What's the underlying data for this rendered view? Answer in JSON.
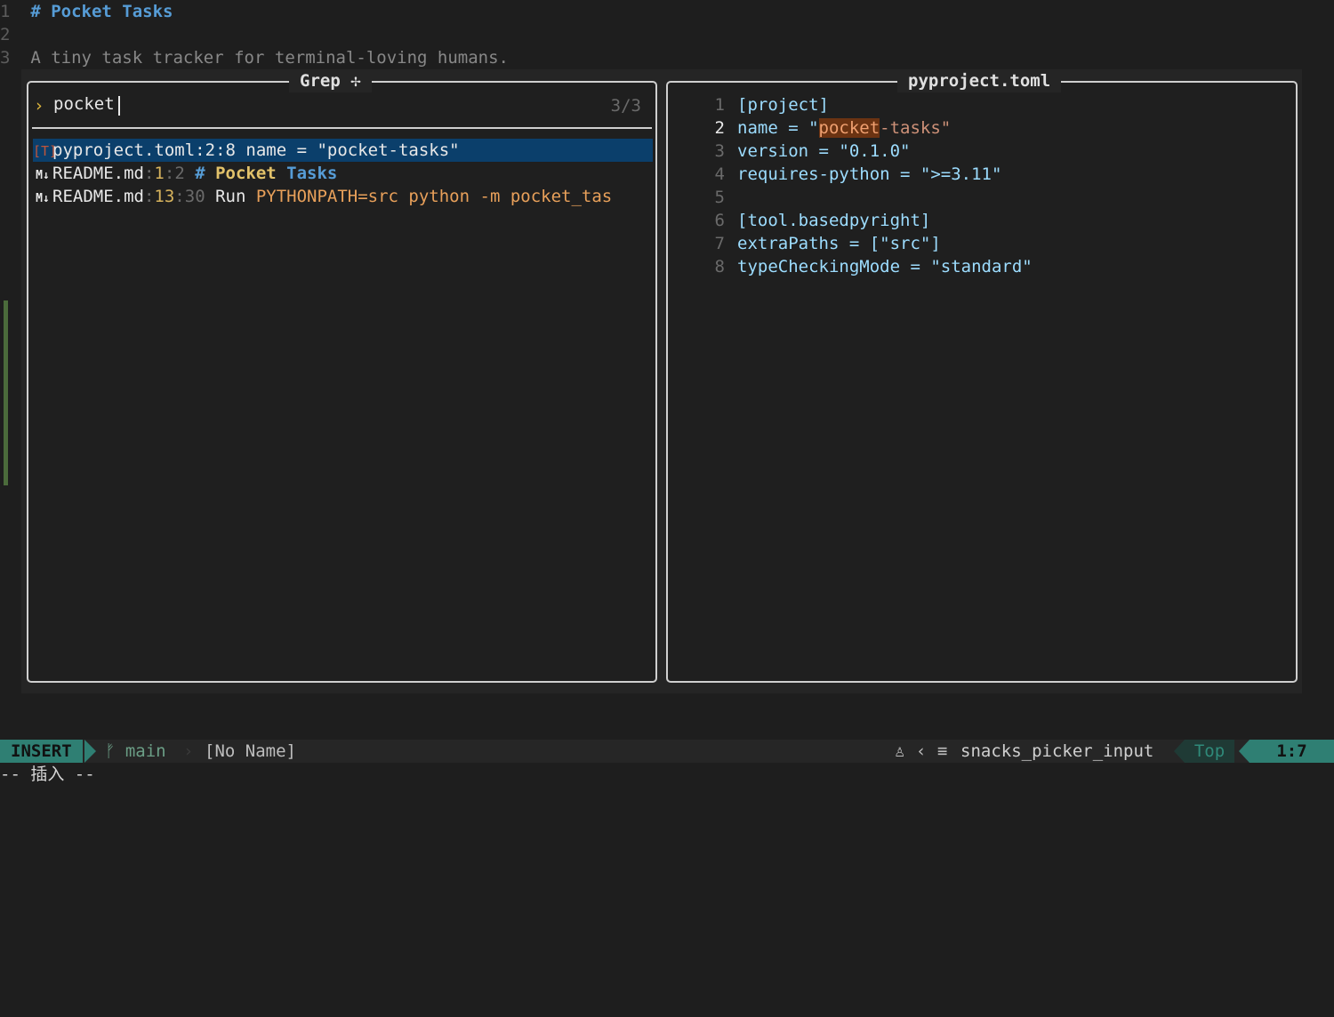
{
  "background_editor": {
    "lines": [
      {
        "num": "1",
        "text": "# Pocket Tasks"
      },
      {
        "num": "2",
        "text": ""
      },
      {
        "num": "3",
        "text": "A tiny task tracker for terminal-loving humans."
      }
    ]
  },
  "picker": {
    "title": "Grep",
    "title_icon": "✢",
    "prompt": "›",
    "query": "pocket",
    "match_count": "3/3",
    "results": [
      {
        "icon": "[T]",
        "file": "pyproject.toml",
        "sep1": ":",
        "line": "2",
        "sep2": ":",
        "col": "8",
        "text_pre": " name = \"pocket-tasks\"",
        "text_hl": "",
        "text_post": ""
      },
      {
        "icon": "M↓",
        "file": "README.md",
        "sep1": ":",
        "line": "1",
        "sep2": ":",
        "col": "2",
        "text_pre": " # ",
        "text_hl": "Pocket",
        "text_post": " Tasks"
      },
      {
        "icon": "M↓",
        "file": "README.md",
        "sep1": ":",
        "line": "13",
        "sep2": ":",
        "col": "30",
        "text_pre": " Run ",
        "text_hl": "PYTHONPATH=src python -m pocket_tas",
        "text_post": ""
      }
    ]
  },
  "preview": {
    "title": "pyproject.toml",
    "lines": [
      {
        "num": "1",
        "a": "[project]"
      },
      {
        "num": "2",
        "a": "name = \"",
        "hl": "pocket",
        "b": "-tasks\""
      },
      {
        "num": "3",
        "a": "version = \"0.1.0\""
      },
      {
        "num": "4",
        "a": "requires-python = \">=3.11\""
      },
      {
        "num": "5",
        "a": ""
      },
      {
        "num": "6",
        "a": "[tool.basedpyright]"
      },
      {
        "num": "7",
        "a": "extraPaths = [\"src\"]"
      },
      {
        "num": "8",
        "a": "typeCheckingMode = \"standard\""
      }
    ]
  },
  "statusline": {
    "mode": "INSERT",
    "branch_icon": "ᚠ",
    "branch": "main",
    "separator": "›",
    "filename": "[No Name]",
    "os_icon": "♙",
    "lt": "‹",
    "filetype_icon": "≡",
    "filetype": "snacks_picker_input",
    "position": "Top",
    "cursor": "1:7"
  },
  "cmdline": "-- 插入 --"
}
